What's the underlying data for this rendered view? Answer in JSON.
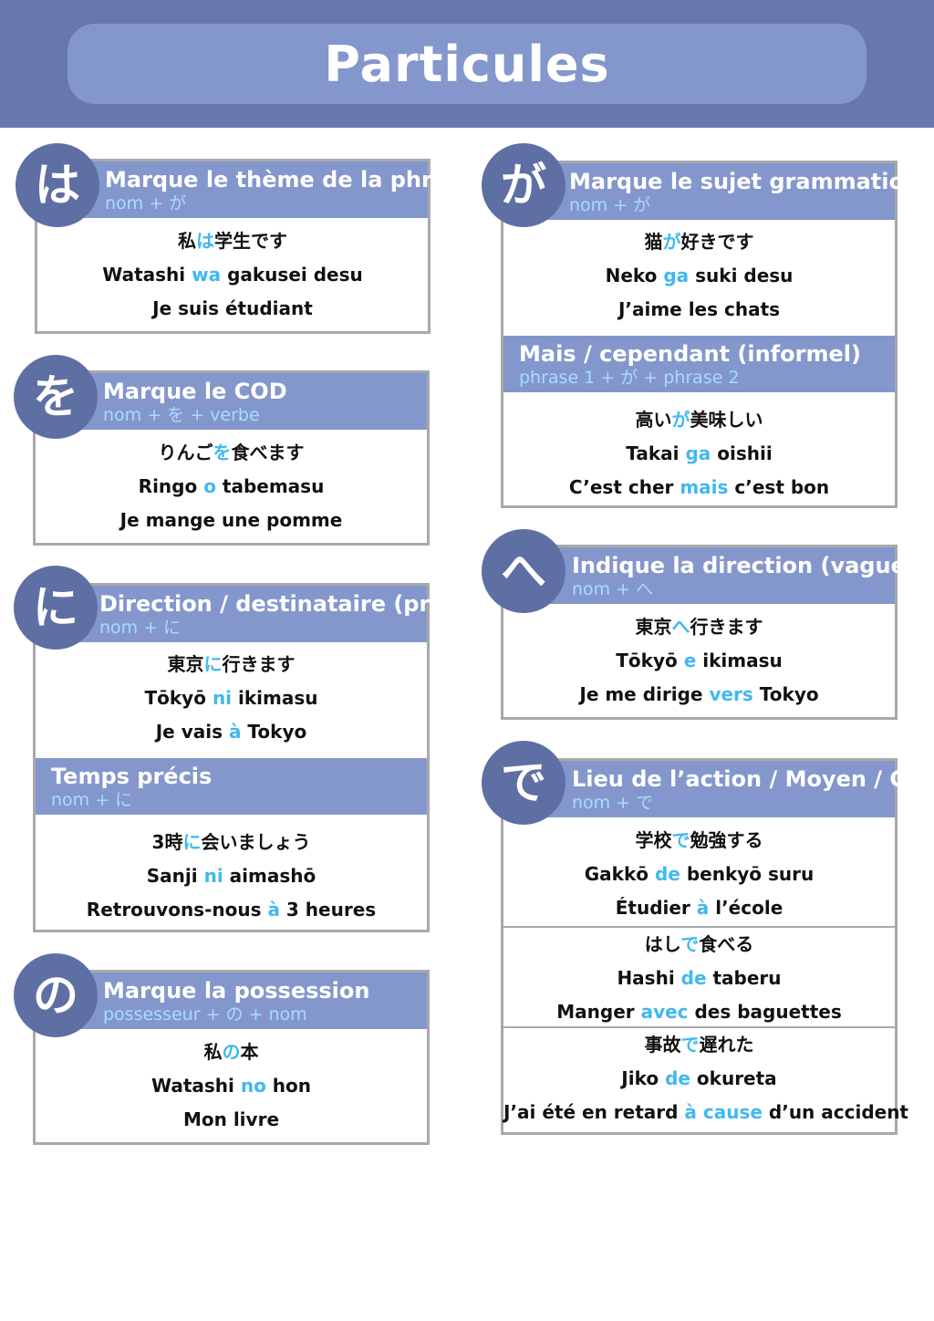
{
  "title": "Particules",
  "colors": {
    "topbar": "#6678ae",
    "header": "#8497cc",
    "circle": "#5e6fa4",
    "highlight": "#41b8f0",
    "formula": "#a6dcff",
    "border": "#a9a9a9"
  },
  "wa": {
    "kana": "は",
    "title": "Marque le thème de la phrase",
    "formula": "nom + が",
    "ex": {
      "jp1": "私",
      "jpp": "は",
      "jp2": "学生です",
      "ro1": "Watashi ",
      "rop": "wa",
      "ro2": " gakusei desu",
      "fr": "Je suis étudiant"
    }
  },
  "o": {
    "kana": "を",
    "title": "Marque le COD",
    "formula": "nom + を + verbe",
    "ex": {
      "jp1": "りんご",
      "jpp": "を",
      "jp2": "食べます",
      "ro1": "Ringo ",
      "rop": "o",
      "ro2": " tabemasu",
      "fr": "Je mange une pomme"
    }
  },
  "ni": {
    "kana": "に",
    "title": "Direction / destinataire (précis)",
    "formula": "nom + に",
    "ex": {
      "jp1": "東京",
      "jpp": "に",
      "jp2": "行きます",
      "ro1": "Tōkyō ",
      "rop": "ni",
      "ro2": " ikimasu",
      "fr1": "Je vais ",
      "frp": "à",
      "fr2": " Tokyo"
    },
    "sub": {
      "title": "Temps précis",
      "formula": "nom + に",
      "ex": {
        "jp1": "3時",
        "jpp": "に",
        "jp2": "会いましょう",
        "ro1": "Sanji ",
        "rop": "ni",
        "ro2": " aimashō",
        "fr1": "Retrouvons-nous ",
        "frp": "à",
        "fr2": " 3 heures"
      }
    }
  },
  "no": {
    "kana": "の",
    "title": "Marque la possession",
    "formula": "possesseur + の + nom",
    "ex": {
      "jp1": "私",
      "jpp": "の",
      "jp2": "本",
      "ro1": "Watashi ",
      "rop": "no",
      "ro2": " hon",
      "fr": "Mon livre"
    }
  },
  "ga": {
    "kana": "が",
    "title": "Marque le sujet grammatical",
    "formula": "nom + が",
    "ex": {
      "jp1": "猫",
      "jpp": "が",
      "jp2": "好きです",
      "ro1": "Neko ",
      "rop": "ga",
      "ro2": " suki desu",
      "fr": "J’aime les chats"
    },
    "sub": {
      "title": "Mais / cependant (informel)",
      "formula": "phrase 1 + が + phrase 2",
      "ex": {
        "jp1": "高い",
        "jpp": "が",
        "jp2": "美味しい",
        "ro1": "Takai ",
        "rop": "ga",
        "ro2": " oishii",
        "fr1": "C’est cher ",
        "frp": "mais",
        "fr2": " c’est bon"
      }
    }
  },
  "e": {
    "kana": "へ",
    "title": "Indique la direction (vague)",
    "formula": "nom + へ",
    "ex": {
      "jp1": "東京",
      "jpp": "へ",
      "jp2": "行きます",
      "ro1": "Tōkyō ",
      "rop": "e",
      "ro2": " ikimasu",
      "fr1": "Je me dirige ",
      "frp": "vers",
      "fr2": " Tokyo"
    }
  },
  "de": {
    "kana": "で",
    "title": "Lieu de l’action / Moyen / Cause",
    "formula": "nom + で",
    "ex1": {
      "jp1": "学校",
      "jpp": "で",
      "jp2": "勉強する",
      "ro1": "Gakkō ",
      "rop": "de",
      "ro2": " benkyō suru",
      "fr1": "Étudier ",
      "frp": "à",
      "fr2": " l’école"
    },
    "ex2": {
      "jp1": "はし",
      "jpp": "で",
      "jp2": "食べる",
      "ro1": "Hashi ",
      "rop": "de",
      "ro2": " taberu",
      "fr1": "Manger ",
      "frp": "avec",
      "fr2": " des baguettes"
    },
    "ex3": {
      "jp1": "事故",
      "jpp": "で",
      "jp2": "遅れた",
      "ro1": "Jiko ",
      "rop": "de",
      "ro2": " okureta",
      "fr1": "J’ai été en retard ",
      "frp": "à cause",
      "fr2": " d’un accident"
    }
  }
}
